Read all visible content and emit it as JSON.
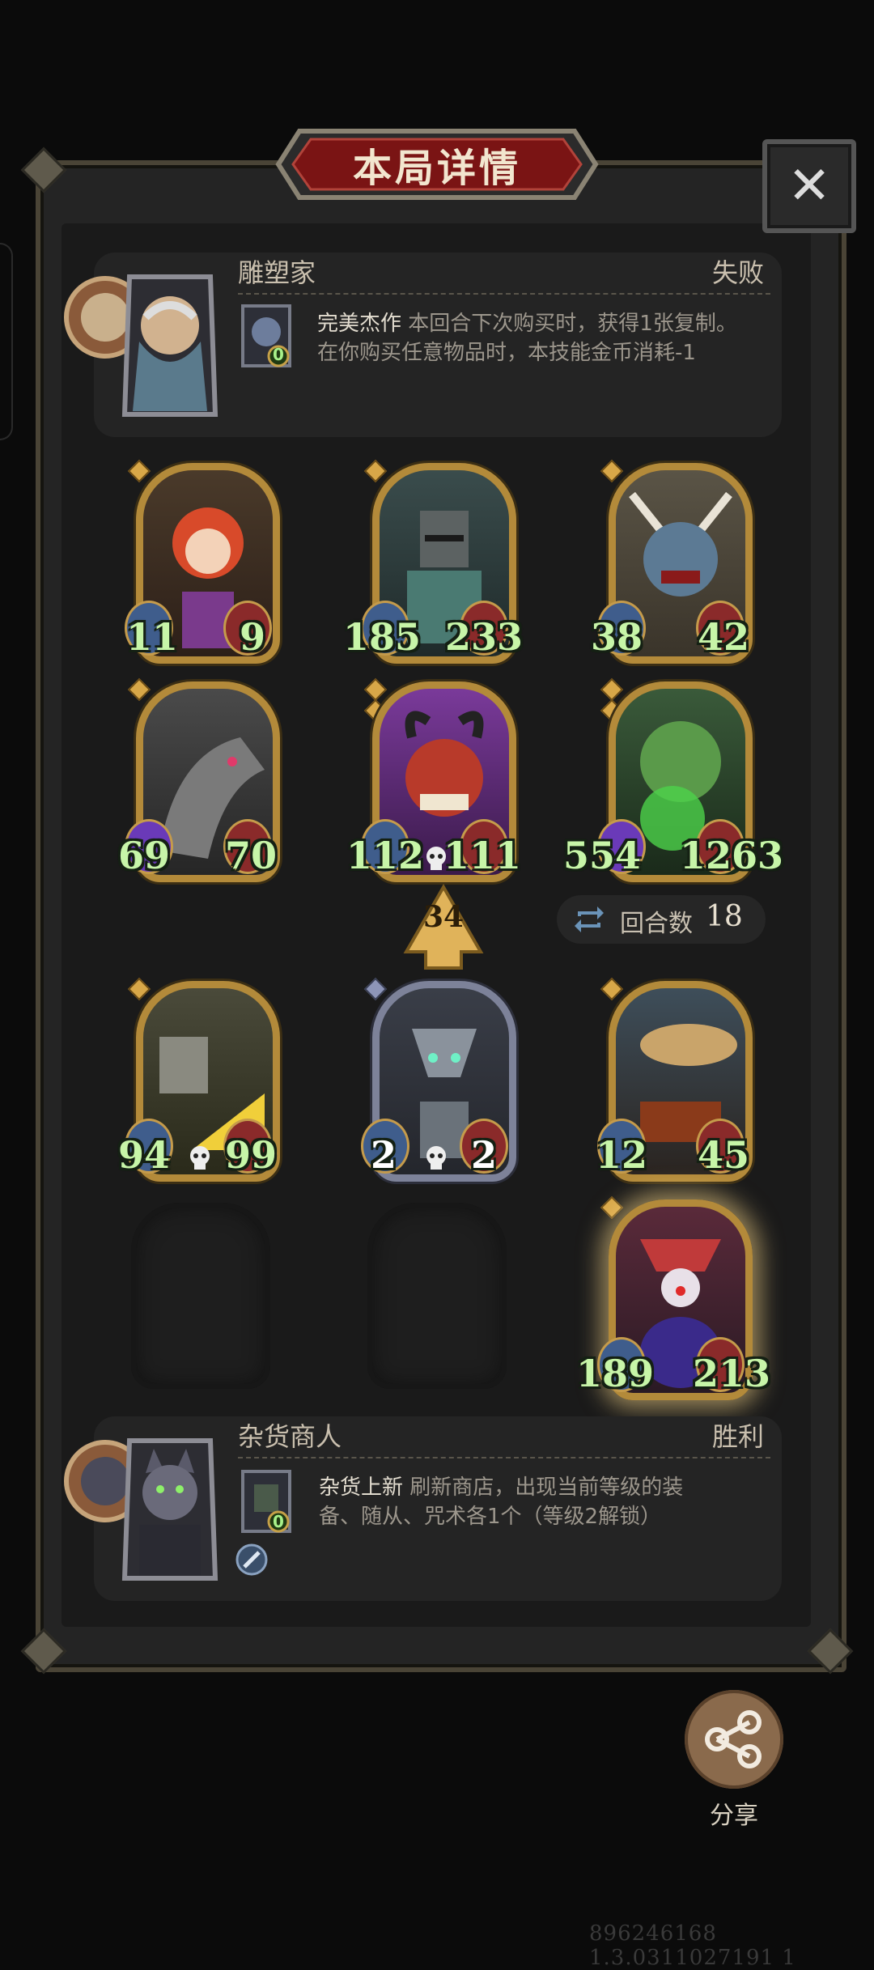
{
  "title": "本局详情",
  "close_icon": "close-icon",
  "top_player": {
    "name": "雕塑家",
    "result": "失败",
    "skill": {
      "name": "完美杰作",
      "desc_line1": "本回合下次购买时，获得1张复制。",
      "desc_line2": "在你购买任意物品时，本技能金币消耗-1",
      "cost": "0"
    }
  },
  "board": {
    "row1": [
      {
        "atk": "11",
        "hp": "9"
      },
      {
        "atk": "185",
        "hp": "233"
      },
      {
        "atk": "38",
        "hp": "42"
      }
    ],
    "row2": [
      {
        "atk": "69",
        "hp": "70"
      },
      {
        "atk": "112",
        "hp": "111"
      },
      {
        "atk": "554",
        "hp": "1263"
      }
    ],
    "level": "34",
    "round_label": "回合数",
    "round_value": "18",
    "row3": [
      {
        "atk": "94",
        "hp": "99"
      },
      {
        "atk": "2",
        "hp": "2"
      },
      {
        "atk": "12",
        "hp": "45"
      }
    ],
    "row4_last": {
      "atk": "189",
      "hp": "213"
    }
  },
  "bottom_player": {
    "name": "杂货商人",
    "result": "胜利",
    "skill": {
      "name": "杂货上新",
      "desc_line1": "刷新商店，出现当前等级的装",
      "desc_line2": "备、随从、咒术各1个（等级2解锁）",
      "cost": "0"
    }
  },
  "share_label": "分享",
  "watermark": "896246168 1.3.0311027191 1"
}
